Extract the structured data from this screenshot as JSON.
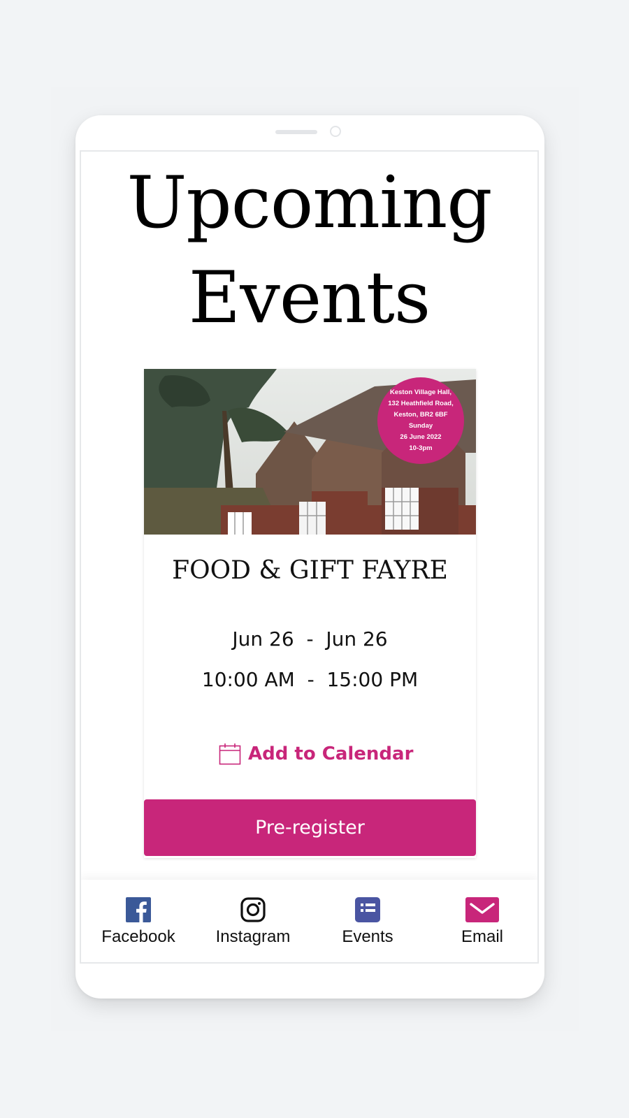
{
  "page": {
    "title": "Upcoming Events"
  },
  "event": {
    "badge_lines": [
      "Keston Village Hall,",
      "132 Heathfield Road,",
      "Keston, BR2 6BF",
      "Sunday",
      "26 June 2022",
      "10-3pm"
    ],
    "title": "FOOD & GIFT FAYRE",
    "dates": "Jun 26  -  Jun 26",
    "times": "10:00 AM  -  15:00 PM",
    "add_to_calendar": "Add to Calendar",
    "register_label": "Pre-register"
  },
  "nav": {
    "items": [
      {
        "label": "Facebook",
        "icon": "facebook-icon"
      },
      {
        "label": "Instagram",
        "icon": "instagram-icon"
      },
      {
        "label": "Events",
        "icon": "events-list-icon"
      },
      {
        "label": "Email",
        "icon": "email-icon"
      }
    ]
  },
  "colors": {
    "accent": "#c8267a",
    "nav_blue": "#3b5998",
    "events_blue": "#4a55a2"
  }
}
